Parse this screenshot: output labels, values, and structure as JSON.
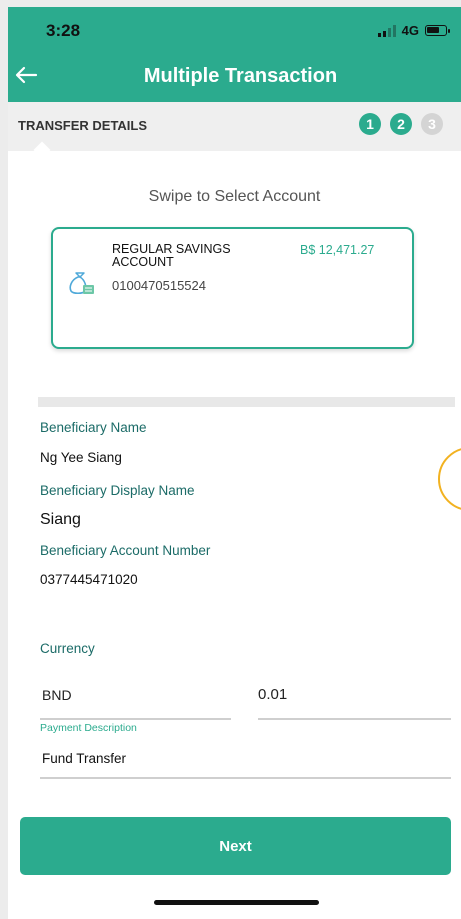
{
  "status_bar": {
    "time": "3:28",
    "network": "4G"
  },
  "header": {
    "title": "Multiple Transaction"
  },
  "step_bar": {
    "label": "TRANSFER DETAILS",
    "steps": [
      "1",
      "2",
      "3"
    ],
    "current_step": 2
  },
  "account_selector": {
    "instruction": "Swipe to Select Account",
    "account_name": "REGULAR SAVINGS ACCOUNT",
    "account_number": "0100470515524",
    "balance": "B$ 12,471.27"
  },
  "beneficiary": {
    "name_label": "Beneficiary Name",
    "name_value": "Ng Yee Siang",
    "display_name_label": "Beneficiary Display Name",
    "display_name_value": "Siang",
    "account_number_label": "Beneficiary Account Number",
    "account_number_value": "0377445471020"
  },
  "payment": {
    "currency_label": "Currency",
    "currency_value": "BND",
    "amount_value": "0.01",
    "description_label": "Payment Description",
    "description_value": "Fund Transfer"
  },
  "actions": {
    "next_label": "Next"
  },
  "colors": {
    "primary": "#2bab8e",
    "label": "#1b6b67",
    "highlight_ring": "#f2b221"
  }
}
